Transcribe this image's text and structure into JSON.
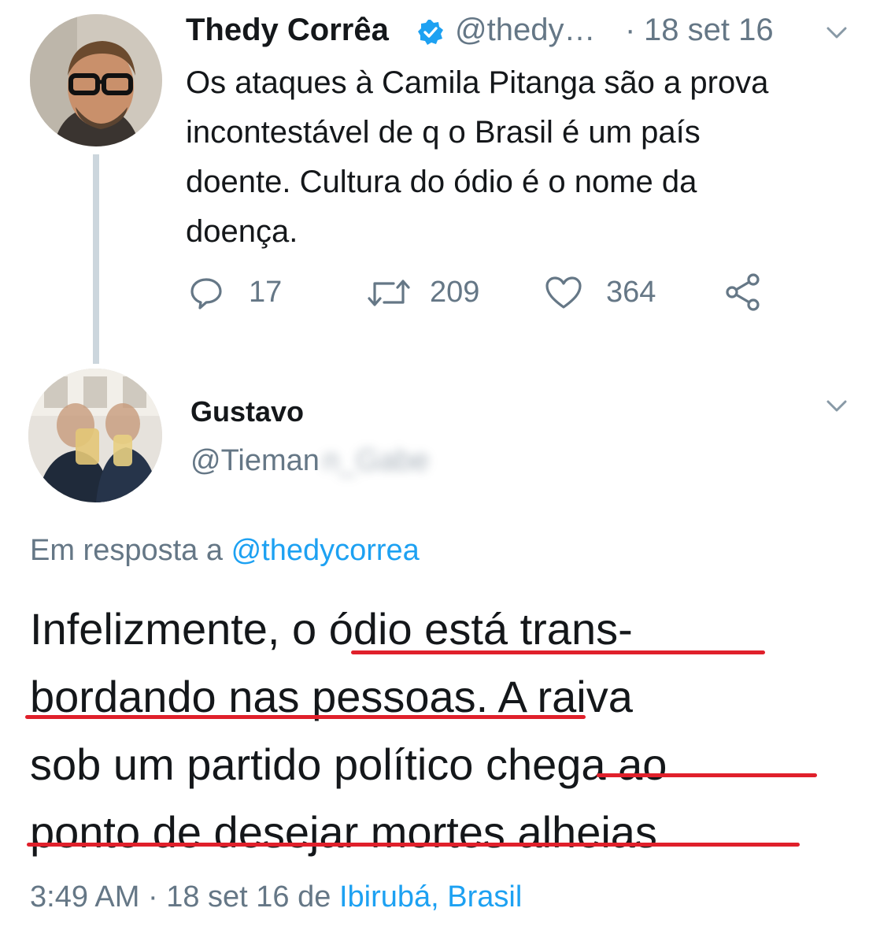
{
  "original_tweet": {
    "author_name": "Thedy Corrêa",
    "handle": "@thedy…",
    "separator": "·",
    "date": "18 set 16",
    "text_lines": [
      "Os ataques à Camila Pitanga são a prova",
      "incontestável de q o Brasil é um país",
      "doente. Cultura do ódio é o nome da",
      "doença."
    ],
    "replies_count": "17",
    "retweets_count": "209",
    "likes_count": "364",
    "icons": [
      "verified-badge-icon",
      "chevron-down-icon",
      "reply-icon",
      "retweet-icon",
      "like-heart-icon",
      "share-icon"
    ],
    "colors": {
      "verified": "#1da1f2",
      "muted_text": "#657786",
      "thread_line": "#ccd6dd"
    }
  },
  "reply_tweet": {
    "author_name": "Gustavo",
    "handle_visible": "@Tieman",
    "handle_blurred": "n_Gabe",
    "in_reply_to_label": "Em resposta a",
    "in_reply_to_mention": "@thedycorrea",
    "text_segments": {
      "line1_a": "Infelizmente, ",
      "line1_b": "o ódio está trans-",
      "line2_a": "bordando nas pessoas.",
      "line2_b": " A raiva",
      "line3_a": "sob um partido político ",
      "line3_b": "chega ao",
      "line4": "ponto de desejar mortes alheias"
    },
    "time": "3:49 AM",
    "separator": "·",
    "date": "18 set 16",
    "from_label": "de",
    "location": "Ibirubá, Brasil",
    "colors": {
      "link": "#1da1f2",
      "underline": "#e0202b"
    }
  }
}
